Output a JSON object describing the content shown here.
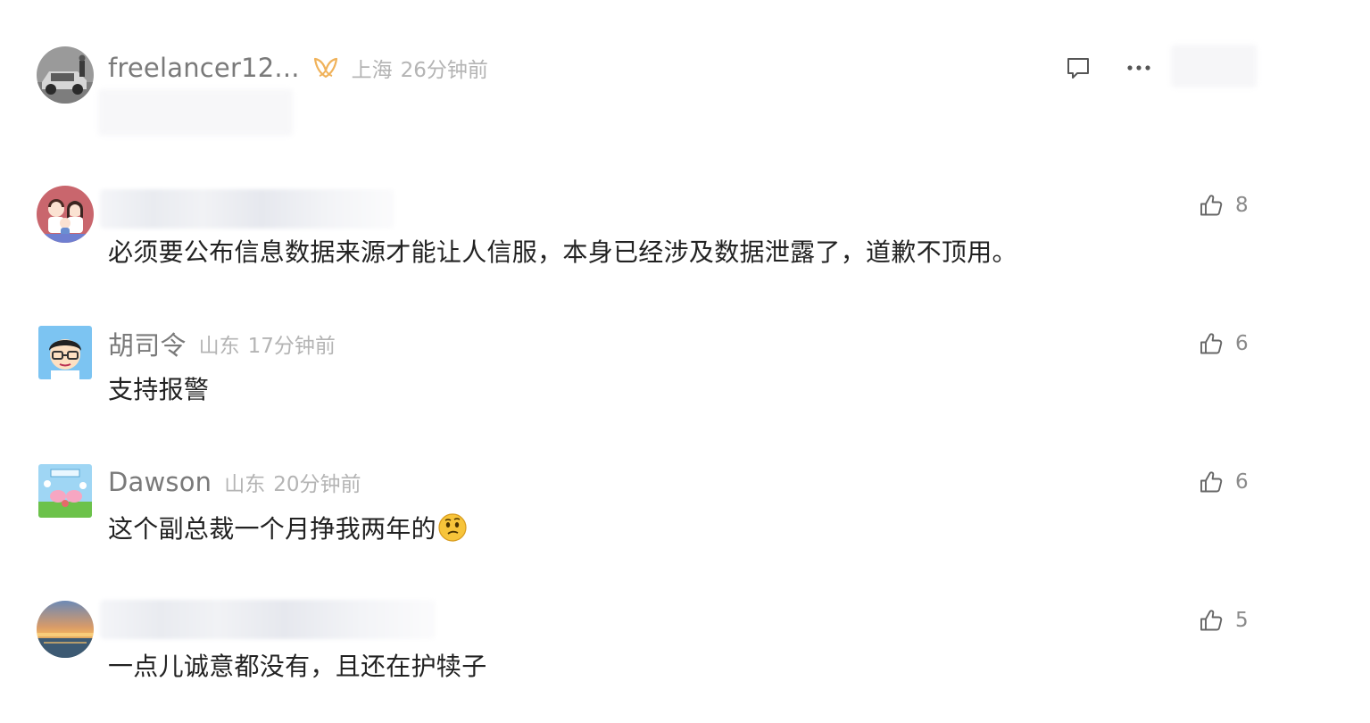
{
  "comments": [
    {
      "username": "freelancer12...",
      "location": "上海",
      "time": "26分钟前",
      "text": "",
      "reply_icon": "comment-icon",
      "more_icon": "more-icon"
    },
    {
      "username": "",
      "location": "",
      "time": "",
      "text": "必须要公布信息数据来源才能让人信服，本身已经涉及数据泄露了，道歉不顶用。",
      "likes": "8"
    },
    {
      "username": "胡司令",
      "location": "山东",
      "time": "17分钟前",
      "text": "支持报警",
      "likes": "6"
    },
    {
      "username": "Dawson",
      "location": "山东",
      "time": "20分钟前",
      "text": "这个副总裁一个月挣我两年的",
      "emoji": "thinking-face-emoji",
      "likes": "6"
    },
    {
      "username": "",
      "location": "",
      "time": "",
      "text": "一点儿诚意都没有，且还在护犊子",
      "likes": "5"
    }
  ],
  "icons": {
    "like": "thumbs-up-icon",
    "badge": "vip-badge-icon"
  },
  "colors": {
    "username": "#7a7a7a",
    "meta": "#b4b4b4",
    "text": "#222222",
    "badge": "#f0b25a"
  }
}
